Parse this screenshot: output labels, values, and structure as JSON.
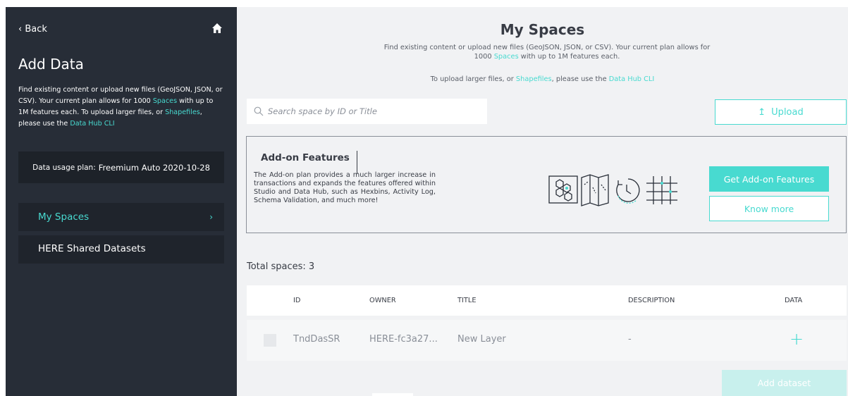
{
  "sidebar": {
    "back_label": "Back",
    "back_chevron": "‹",
    "title": "Add Data",
    "desc_part1": "Find existing content or upload new files (GeoJSON, JSON, or CSV). Your current plan allows for 1000 ",
    "desc_spaces_link": "Spaces",
    "desc_part2": " with up to 1M features each. To upload larger files, or ",
    "desc_shapefiles_link": "Shapefiles",
    "desc_part3": ", please use the ",
    "desc_cli_link": "Data Hub CLI",
    "plan_label": "Data usage plan:",
    "plan_value": "Freemium Auto 2020-10-28",
    "nav_items": [
      {
        "label": "My Spaces",
        "chevron": "›"
      },
      {
        "label": "HERE Shared Datasets"
      }
    ]
  },
  "main": {
    "title": "My Spaces",
    "desc_part1": "Find existing content or upload new files (GeoJSON, JSON, or CSV). Your current plan allows for 1000 ",
    "desc_spaces_link": "Spaces",
    "desc_part2": " with up to 1M features each.",
    "desc2_part1": "To upload larger files, or ",
    "desc2_shapefiles_link": "Shapefiles",
    "desc2_part2": ", please use the ",
    "desc2_cli_link": "Data Hub CLI",
    "search_placeholder": "Search space by ID or Title",
    "upload_label": "Upload",
    "upload_arrow": "↥"
  },
  "addon": {
    "title": "Add-on Features",
    "desc": "The Add-on plan provides a much larger increase in transactions and expands the features offered within Studio and Data Hub, such as Hexbins, Activity Log, Schema Validation, and much more!",
    "get_label": "Get Add-on Features",
    "know_more_label": "Know more"
  },
  "table": {
    "total_label": "Total spaces: 3",
    "columns": [
      "ID",
      "OWNER",
      "TITLE",
      "DESCRIPTION",
      "DATA"
    ],
    "rows": [
      {
        "id": "TndDasSR",
        "owner": "HERE-fc3a27...",
        "title": "New Layer",
        "description": "-",
        "data": "+"
      }
    ]
  },
  "add_dataset_label": "Add dataset",
  "colors": {
    "accent": "#48dad0",
    "sidebar_bg": "#272d37",
    "main_bg": "#f1f2f4"
  }
}
